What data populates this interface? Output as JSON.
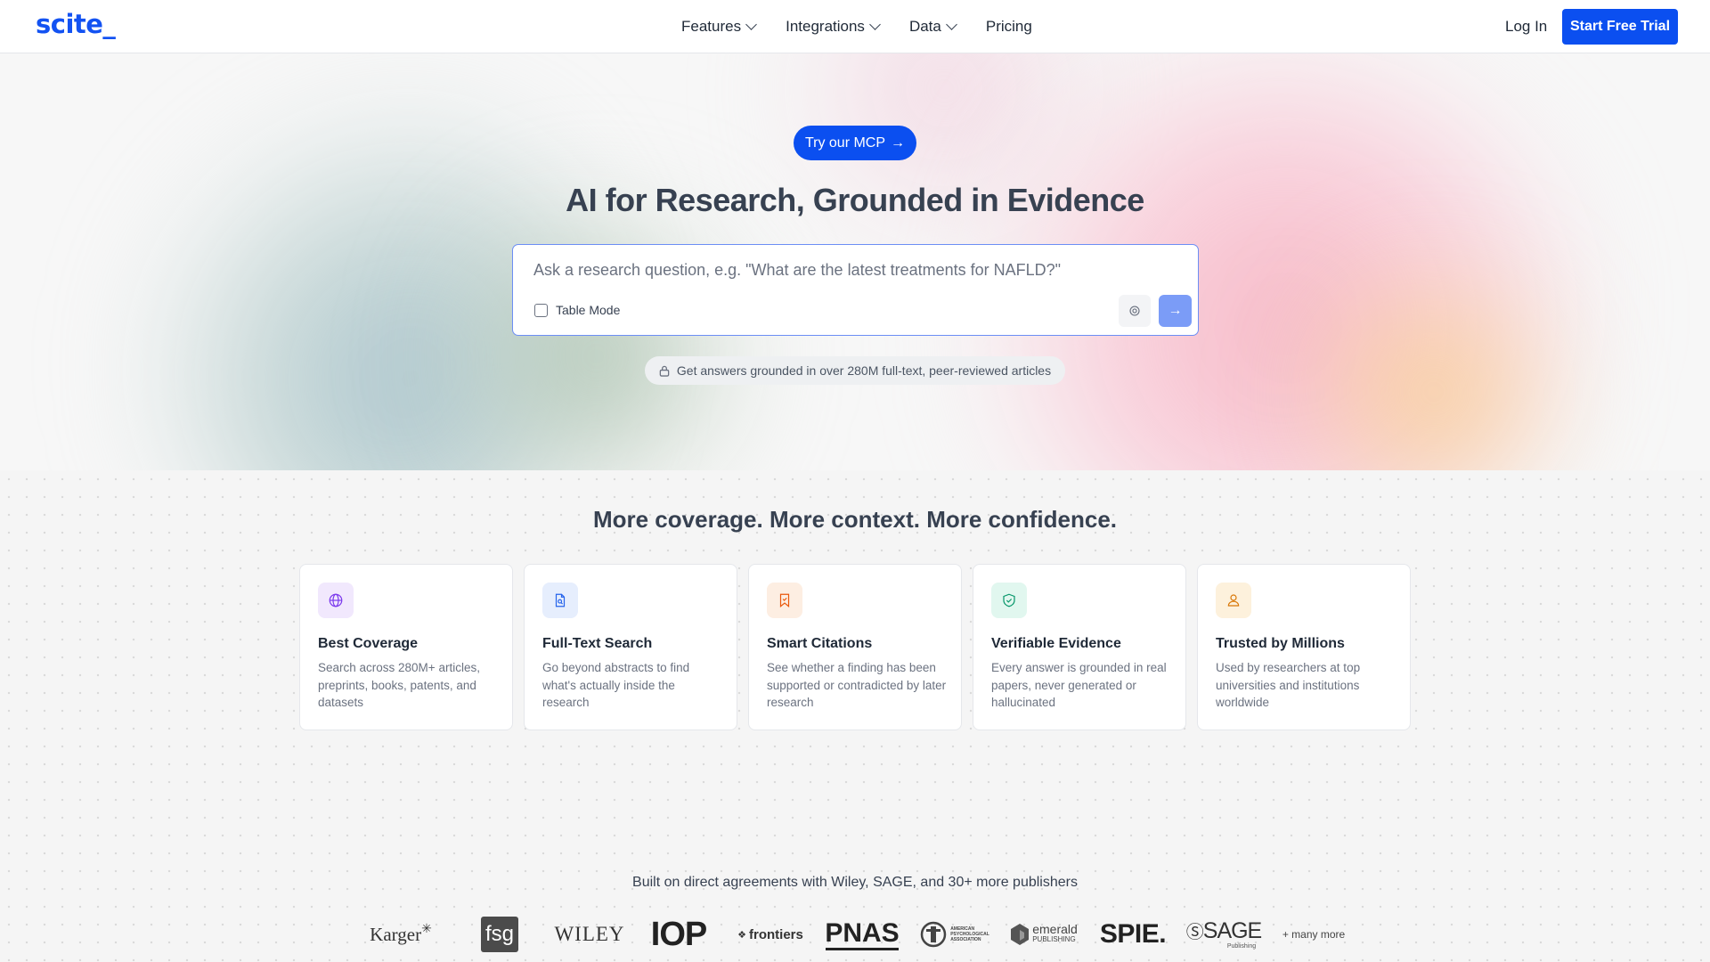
{
  "header": {
    "logo": "scite_",
    "nav": [
      {
        "label": "Features"
      },
      {
        "label": "Integrations"
      },
      {
        "label": "Data"
      },
      {
        "label": "Pricing"
      }
    ],
    "login": "Log In",
    "cta": "Start Free Trial"
  },
  "hero": {
    "mcp_button": "Try our MCP",
    "mcp_arrow": "→",
    "title": "AI for Research, Grounded in Evidence",
    "search_placeholder": "Ask a research question, e.g. \"What are the latest treatments for NAFLD?\"",
    "table_mode_label": "Table Mode",
    "table_mode_checked": false,
    "submit_arrow": "→",
    "pill_text": "Get answers grounded in over 280M full-text, peer-reviewed articles"
  },
  "features": {
    "title": "More coverage. More context. More confidence.",
    "cards": [
      {
        "title": "Best Coverage",
        "desc": "Search across 280M+ articles, preprints, books, patents, and datasets",
        "icon": "globe-icon",
        "color": "#7c3aed",
        "bg": "#f1e8fd"
      },
      {
        "title": "Full-Text Search",
        "desc": "Go beyond abstracts to find what's actually inside the research",
        "icon": "document-search-icon",
        "color": "#2563eb",
        "bg": "#e6eefd"
      },
      {
        "title": "Smart Citations",
        "desc": "See whether a finding has been supported or contradicted by later research",
        "icon": "bookmark-icon",
        "color": "#ea580c",
        "bg": "#fdeee2"
      },
      {
        "title": "Verifiable Evidence",
        "desc": "Every answer is grounded in real papers, never generated or hallucinated",
        "icon": "shield-check-icon",
        "color": "#059669",
        "bg": "#e1f7ef"
      },
      {
        "title": "Trusted by Millions",
        "desc": "Used by researchers at top universities and institutions worldwide",
        "icon": "user-icon",
        "color": "#d97706",
        "bg": "#fdf1dc"
      }
    ],
    "publishers_text": "Built on direct agreements with Wiley, SAGE, and 30+ more publishers",
    "logos": {
      "karger": "Karger",
      "fsg": "fsg",
      "wiley": "WILEY",
      "iop": "IOP",
      "frontiers": "frontiers",
      "pnas": "PNAS",
      "apa_line1": "AMERICAN",
      "apa_line2": "PSYCHOLOGICAL",
      "apa_line3": "ASSOCIATION",
      "emerald_line1": "emerald",
      "emerald_line2": "PUBLISHING",
      "spie": "SPIE.",
      "sage": "SAGE",
      "sage_sub": "Publishing",
      "more": "+ many more"
    }
  }
}
